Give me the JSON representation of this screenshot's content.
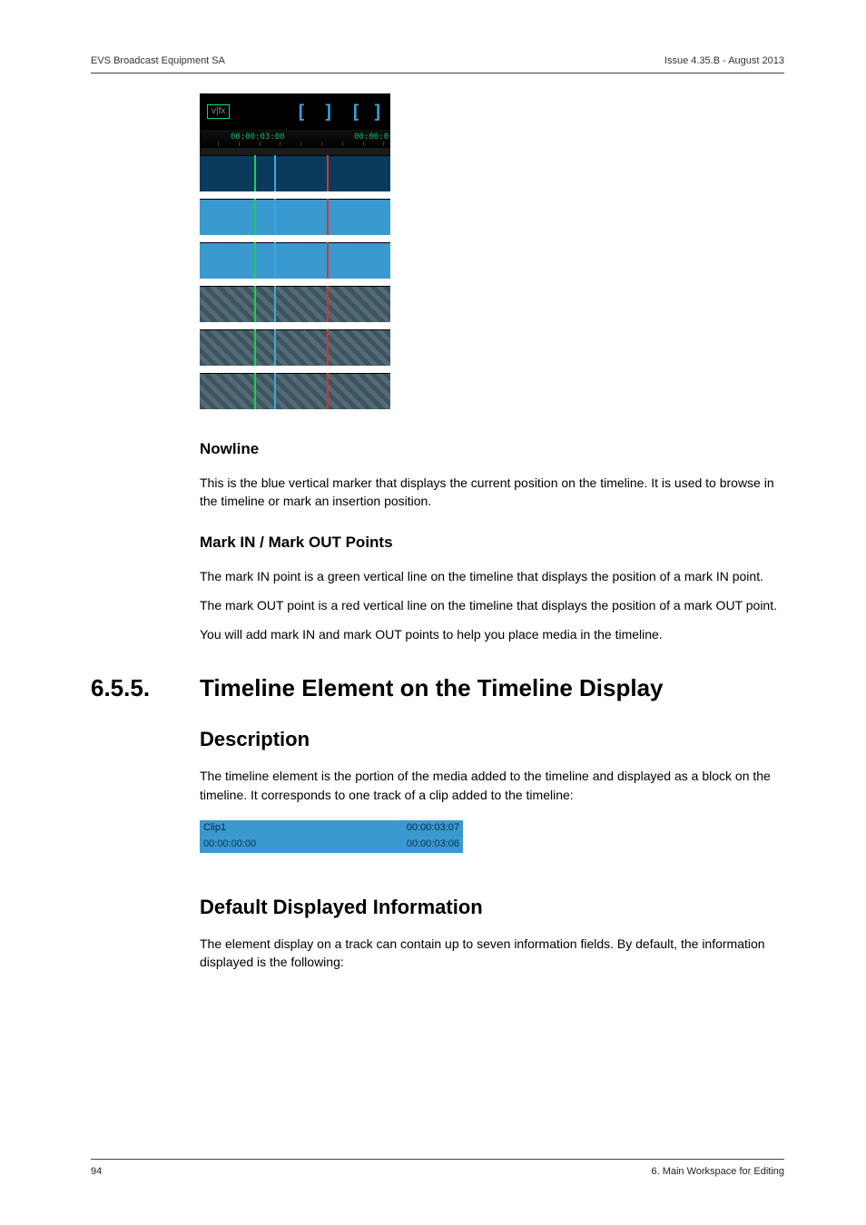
{
  "header": {
    "left": "EVS Broadcast Equipment SA",
    "right": "Issue 4.35.B - August 2013"
  },
  "timeline_image": {
    "vfx_label": "v|fx",
    "bracket_in": "[",
    "bracket_out": "]",
    "bracket_both": "[ ]",
    "tc_left": "00:00:03:00",
    "tc_right": "00:00:0"
  },
  "nowline": {
    "heading": "Nowline",
    "para": "This is the blue vertical marker that displays the current position on the timeline. It is used to browse in the timeline or mark an insertion position."
  },
  "marks": {
    "heading": "Mark IN / Mark OUT Points",
    "para1": "The mark IN point is a green vertical line on the timeline that displays the position of a mark IN point.",
    "para2": "The mark OUT point is a red vertical line on the timeline that displays the position of a mark OUT point.",
    "para3": "You will add mark IN and mark OUT points to help you place media in the timeline."
  },
  "section655": {
    "number": "6.5.5.",
    "title": "Timeline Element on the Timeline Display"
  },
  "description": {
    "heading": "Description",
    "para": "The timeline element is the portion of the media added to the timeline and displayed as a block on the timeline. It corresponds to one track of a clip added to the timeline:"
  },
  "clip": {
    "name": "Clip1",
    "tc_top": "00:00:03:07",
    "tc_bottom_left": "00:00:00:00",
    "tc_bottom_right": "00:00:03:06"
  },
  "default_info": {
    "heading": "Default Displayed Information",
    "para": "The element display on a track can contain up to seven information fields. By default, the information displayed is the following:"
  },
  "footer": {
    "page": "94",
    "chapter": "6. Main Workspace for Editing"
  }
}
